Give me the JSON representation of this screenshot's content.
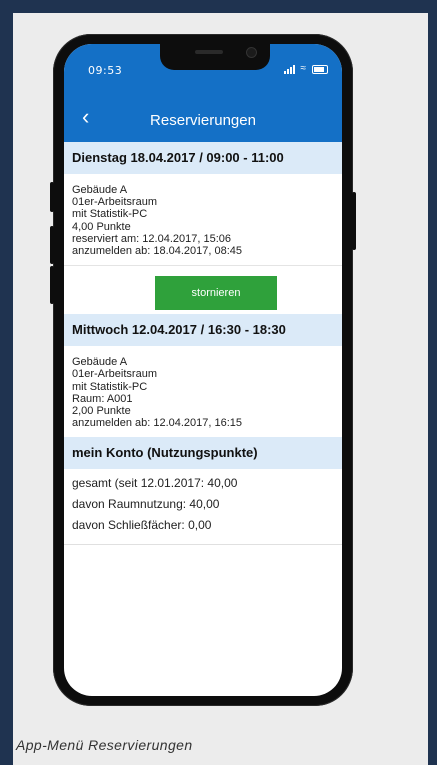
{
  "status_bar": {
    "time": "09:53"
  },
  "nav": {
    "back_icon": "chevron-left-icon",
    "title": "Reservierungen"
  },
  "reservations": [
    {
      "header": "Dienstag 18.04.2017 / 09:00 - 11:00",
      "lines": [
        "Gebäude A",
        "01er-Arbeitsraum",
        "mit Statistik-PC",
        "4,00 Punkte",
        "reserviert am: 12.04.2017, 15:06",
        "anzumelden ab: 18.04.2017, 08:45"
      ],
      "action_label": "stornieren"
    },
    {
      "header": "Mittwoch 12.04.2017 / 16:30 - 18:30",
      "lines": [
        "Gebäude A",
        "01er-Arbeitsraum",
        "mit Statistik-PC",
        "Raum: A001",
        "2,00 Punkte",
        "anzumelden ab: 12.04.2017, 16:15"
      ]
    }
  ],
  "account": {
    "header": "mein Konto (Nutzungspunkte)",
    "lines": [
      "gesamt (seit 12.01.2017: 40,00",
      "davon Raumnutzung: 40,00",
      "davon Schließfächer: 0,00"
    ]
  },
  "caption": "App-Menü Reservierungen",
  "colors": {
    "accent": "#1470c6",
    "section_bg": "#dbeaf8",
    "button": "#2fa13b"
  }
}
